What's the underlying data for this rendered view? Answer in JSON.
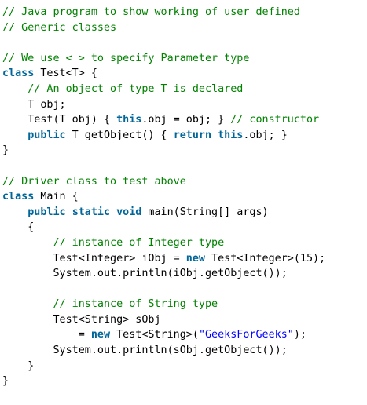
{
  "code": {
    "lines": [
      [
        {
          "t": "comment",
          "v": "// Java program to show working of user defined"
        }
      ],
      [
        {
          "t": "comment",
          "v": "// Generic classes"
        }
      ],
      [],
      [
        {
          "t": "comment",
          "v": "// We use < > to specify Parameter type"
        }
      ],
      [
        {
          "t": "keyword",
          "v": "class"
        },
        {
          "t": "plain",
          "v": " Test<T> {"
        }
      ],
      [
        {
          "t": "plain",
          "v": "    "
        },
        {
          "t": "comment",
          "v": "// An object of type T is declared"
        }
      ],
      [
        {
          "t": "plain",
          "v": "    T obj;"
        }
      ],
      [
        {
          "t": "plain",
          "v": "    Test(T obj) { "
        },
        {
          "t": "keyword",
          "v": "this"
        },
        {
          "t": "plain",
          "v": ".obj = obj; } "
        },
        {
          "t": "comment",
          "v": "// constructor"
        }
      ],
      [
        {
          "t": "plain",
          "v": "    "
        },
        {
          "t": "keyword",
          "v": "public"
        },
        {
          "t": "plain",
          "v": " T getObject() { "
        },
        {
          "t": "keyword",
          "v": "return"
        },
        {
          "t": "plain",
          "v": " "
        },
        {
          "t": "keyword",
          "v": "this"
        },
        {
          "t": "plain",
          "v": ".obj; }"
        }
      ],
      [
        {
          "t": "plain",
          "v": "}"
        }
      ],
      [],
      [
        {
          "t": "comment",
          "v": "// Driver class to test above"
        }
      ],
      [
        {
          "t": "keyword",
          "v": "class"
        },
        {
          "t": "plain",
          "v": " Main {"
        }
      ],
      [
        {
          "t": "plain",
          "v": "    "
        },
        {
          "t": "keyword",
          "v": "public"
        },
        {
          "t": "plain",
          "v": " "
        },
        {
          "t": "keyword",
          "v": "static"
        },
        {
          "t": "plain",
          "v": " "
        },
        {
          "t": "keyword",
          "v": "void"
        },
        {
          "t": "plain",
          "v": " main(String[] args)"
        }
      ],
      [
        {
          "t": "plain",
          "v": "    {"
        }
      ],
      [
        {
          "t": "plain",
          "v": "        "
        },
        {
          "t": "comment",
          "v": "// instance of Integer type"
        }
      ],
      [
        {
          "t": "plain",
          "v": "        Test<Integer> iObj = "
        },
        {
          "t": "keyword",
          "v": "new"
        },
        {
          "t": "plain",
          "v": " Test<Integer>(15);"
        }
      ],
      [
        {
          "t": "plain",
          "v": "        System.out.println(iObj.getObject());"
        }
      ],
      [],
      [
        {
          "t": "plain",
          "v": "        "
        },
        {
          "t": "comment",
          "v": "// instance of String type"
        }
      ],
      [
        {
          "t": "plain",
          "v": "        Test<String> sObj"
        }
      ],
      [
        {
          "t": "plain",
          "v": "            = "
        },
        {
          "t": "keyword",
          "v": "new"
        },
        {
          "t": "plain",
          "v": " Test<String>("
        },
        {
          "t": "string",
          "v": "\"GeeksForGeeks\""
        },
        {
          "t": "plain",
          "v": ");"
        }
      ],
      [
        {
          "t": "plain",
          "v": "        System.out.println(sObj.getObject());"
        }
      ],
      [
        {
          "t": "plain",
          "v": "    }"
        }
      ],
      [
        {
          "t": "plain",
          "v": "}"
        }
      ]
    ]
  },
  "colors": {
    "comment": "#008200",
    "keyword": "#006699",
    "string": "#0000ff",
    "plain": "#000000",
    "background": "#ffffff"
  }
}
